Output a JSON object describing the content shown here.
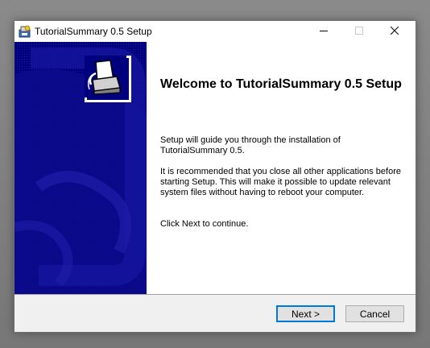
{
  "window": {
    "title": "TutorialSummary 0.5 Setup"
  },
  "titlebar_buttons": {
    "minimize_icon": "minimize-icon",
    "maximize_icon": "maximize-icon",
    "close_icon": "close-icon"
  },
  "welcome": {
    "heading": "Welcome to TutorialSummary 0.5 Setup",
    "paragraph1": "Setup will guide you through the installation of TutorialSummary 0.5.",
    "paragraph2": "It is recommended that you close all other applications before starting Setup. This will make it possible to update relevant system files without having to reboot your computer.",
    "paragraph3": "Click Next to continue."
  },
  "buttons": {
    "next_label": "Next >",
    "cancel_label": "Cancel"
  },
  "colors": {
    "side_panel": "#00007f",
    "accent": "#0078d7"
  }
}
